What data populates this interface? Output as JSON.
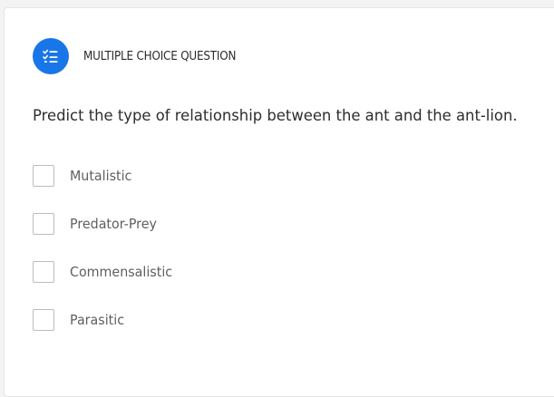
{
  "question": {
    "type_label": "MULTIPLE CHOICE QUESTION",
    "type_icon": "checklist-icon",
    "text": "Predict the type of relationship between the ant and the ant-lion."
  },
  "options": [
    {
      "label": "Mutalistic",
      "checked": false
    },
    {
      "label": "Predator-Prey",
      "checked": false
    },
    {
      "label": "Commensalistic",
      "checked": false
    },
    {
      "label": "Parasitic",
      "checked": false
    }
  ],
  "colors": {
    "accent": "#1976e8",
    "page_background": "#f3f3f3",
    "card_background": "#ffffff",
    "question_text": "#2d2d2d",
    "option_text": "#5f5f5f",
    "checkbox_border": "#bdbdbd"
  }
}
